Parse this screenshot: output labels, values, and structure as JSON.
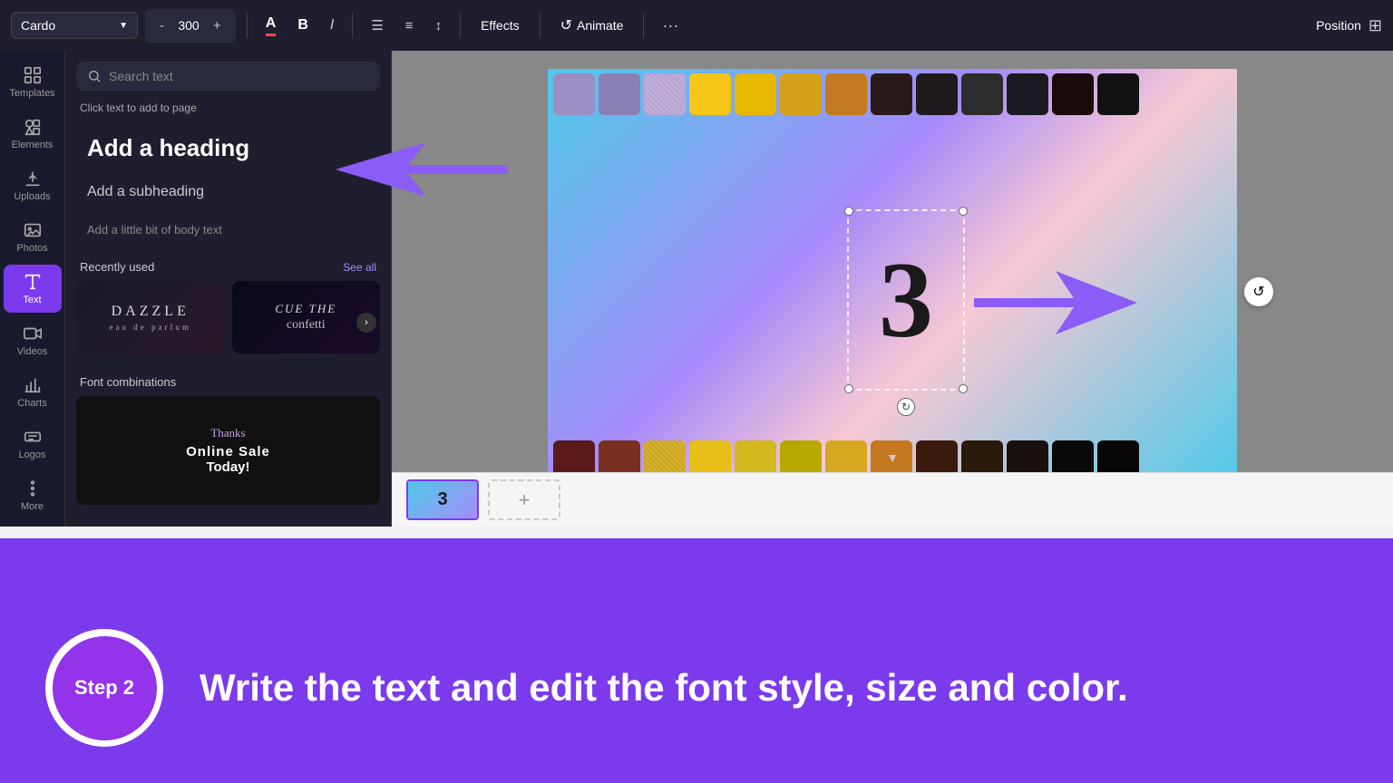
{
  "toolbar": {
    "font_name": "Cardo",
    "font_size": "300",
    "decrease_label": "-",
    "increase_label": "+",
    "bold_label": "B",
    "italic_label": "I",
    "align_icon": "align-icon",
    "list_icon": "list-icon",
    "line_height_icon": "line-height-icon",
    "effects_label": "Effects",
    "animate_label": "Animate",
    "more_label": "···",
    "position_label": "Position",
    "grid_label": "⊞"
  },
  "sidebar": {
    "items": [
      {
        "id": "templates",
        "label": "Templates",
        "icon": "grid-icon"
      },
      {
        "id": "elements",
        "label": "Elements",
        "icon": "elements-icon"
      },
      {
        "id": "uploads",
        "label": "Uploads",
        "icon": "upload-icon"
      },
      {
        "id": "photos",
        "label": "Photos",
        "icon": "photo-icon"
      },
      {
        "id": "text",
        "label": "Text",
        "icon": "text-icon"
      },
      {
        "id": "videos",
        "label": "Videos",
        "icon": "video-icon"
      },
      {
        "id": "charts",
        "label": "Charts",
        "icon": "chart-icon"
      },
      {
        "id": "logos",
        "label": "Logos",
        "icon": "logo-icon"
      },
      {
        "id": "more",
        "label": "More",
        "icon": "more-icon"
      }
    ],
    "active": "text"
  },
  "panel": {
    "search_placeholder": "Search text",
    "click_hint": "Click text to add to page",
    "heading_label": "Add a heading",
    "subheading_label": "Add a subheading",
    "body_label": "Add a little bit of body text",
    "recently_used_title": "Recently used",
    "see_all_label": "See all",
    "font_comb_title": "Font combinations",
    "font1": {
      "main": "DAZZLE",
      "sub": "eau de parfum"
    },
    "font2": {
      "line1": "CUE THE",
      "line2": "confetti"
    }
  },
  "canvas": {
    "number_text": "3",
    "filmstrip_colors_top": [
      "#9b8ec4",
      "#8a7fb5",
      "#b0a0c8",
      "#f5c518",
      "#e8b800",
      "#d4a017",
      "#c47a20",
      "#2a1a1a",
      "#1e1a1e",
      "#2c2c2c",
      "#1a1a22",
      "#1a0a0a"
    ],
    "filmstrip_colors_bottom": [
      "#5a1a1a",
      "#7a3020",
      "#c8a020",
      "#e8c018",
      "#d4b820",
      "#b8a800",
      "#d4a820",
      "#c47820",
      "#3a1a0a",
      "#2a1a0a",
      "#1a1010",
      "#0a0808"
    ]
  },
  "timeline": {
    "slide_number": "3",
    "add_slide_icon": "+"
  },
  "bottom_section": {
    "step_label": "Step 2",
    "step_text": "Write the text and edit the font style, size and color."
  }
}
